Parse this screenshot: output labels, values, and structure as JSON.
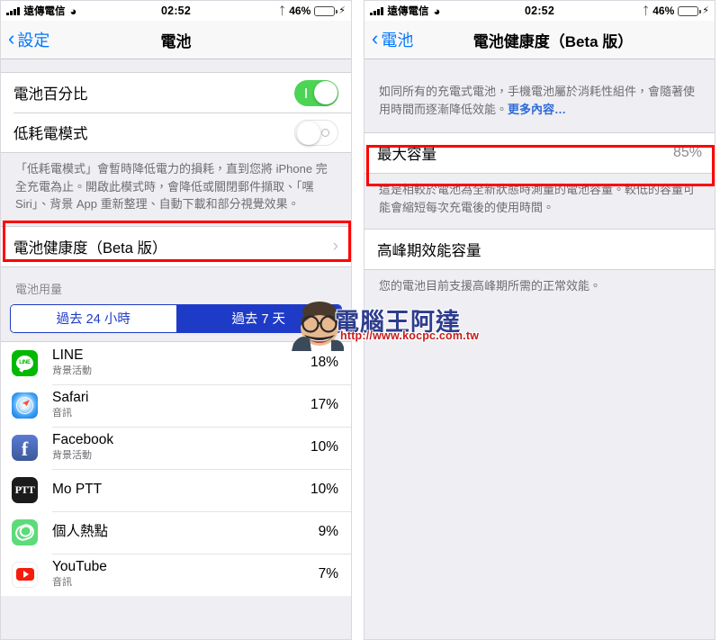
{
  "statusbar": {
    "carrier": "遠傳電信",
    "time": "02:52",
    "battery_percent": "46%",
    "wifi_icon": "wifi-icon",
    "bluetooth_icon": "bluetooth-icon",
    "charging_icon": "lightning-bolt-icon"
  },
  "left_panel": {
    "nav": {
      "back_label": "設定",
      "title": "電池"
    },
    "rows": [
      {
        "label": "電池百分比",
        "toggle": "on"
      },
      {
        "label": "低耗電模式",
        "toggle": "off"
      }
    ],
    "low_power_note": "「低耗電模式」會暫時降低電力的損耗，直到您將 iPhone 完全充電為止。開啟此模式時，會降低或關閉郵件擷取、「嘿 Siri」、背景 App 重新整理、自動下載和部分視覺效果。",
    "battery_health_row": {
      "label": "電池健康度（Beta 版）",
      "chevron": "chevron-right-icon",
      "highlighted": true
    },
    "usage_section_header": "電池用量",
    "segmented": {
      "options": [
        "過去 24 小時",
        "過去 7 天"
      ],
      "selected_index": 1
    },
    "apps": [
      {
        "name": "LINE",
        "subtitle": "背景活動",
        "percent": "18%",
        "icon": "line-icon"
      },
      {
        "name": "Safari",
        "subtitle": "音訊",
        "percent": "17%",
        "icon": "safari-icon"
      },
      {
        "name": "Facebook",
        "subtitle": "背景活動",
        "percent": "10%",
        "icon": "facebook-icon"
      },
      {
        "name": "Mo PTT",
        "subtitle": "",
        "percent": "10%",
        "icon": "moptt-icon"
      },
      {
        "name": "個人熱點",
        "subtitle": "",
        "percent": "9%",
        "icon": "hotspot-icon"
      },
      {
        "name": "YouTube",
        "subtitle": "音訊",
        "percent": "7%",
        "icon": "youtube-icon"
      }
    ]
  },
  "right_panel": {
    "nav": {
      "back_label": "電池",
      "title": "電池健康度（Beta 版）"
    },
    "intro_note": "如同所有的充電式電池，手機電池屬於消耗性組件，會隨著使用時間而逐漸降低效能。",
    "intro_link": "更多內容…",
    "max_capacity": {
      "label": "最大容量",
      "value": "85%",
      "highlighted": true
    },
    "max_capacity_note": "這是相較於電池為全新狀態時測量的電池容量。較低的容量可能會縮短每次充電後的使用時間。",
    "peak_performance": {
      "label": "高峰期效能容量"
    },
    "peak_performance_note": "您的電池目前支援高峰期所需的正常效能。"
  },
  "watermark": {
    "text": "電腦王阿達",
    "url": "http://www.kocpc.com.tw"
  },
  "colors": {
    "ios_blue": "#0076ff",
    "segment_blue": "#1e3bc8",
    "toggle_green": "#4cd455",
    "highlight_red": "#ff0000",
    "watermark_navy": "#2e3d8e",
    "watermark_red": "#c81a1a"
  }
}
